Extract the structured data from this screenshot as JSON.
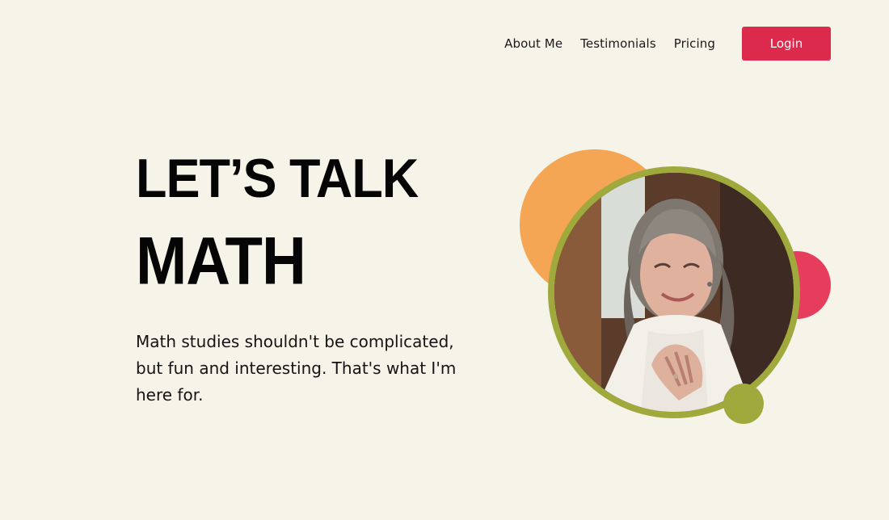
{
  "nav": {
    "links": [
      "About Me",
      "Testimonials",
      "Pricing"
    ],
    "login_label": "Login"
  },
  "hero": {
    "title_line1": "LET’S TALK",
    "title_line2": "MATH",
    "description": "Math studies shouldn't be complicated, but fun and interesting. That's what I'm here for."
  },
  "colors": {
    "background": "#f6f3e8",
    "accent_red": "#dc2a4d",
    "orange": "#f4a654",
    "pink": "#e63d5d",
    "olive": "#a0a93c"
  }
}
